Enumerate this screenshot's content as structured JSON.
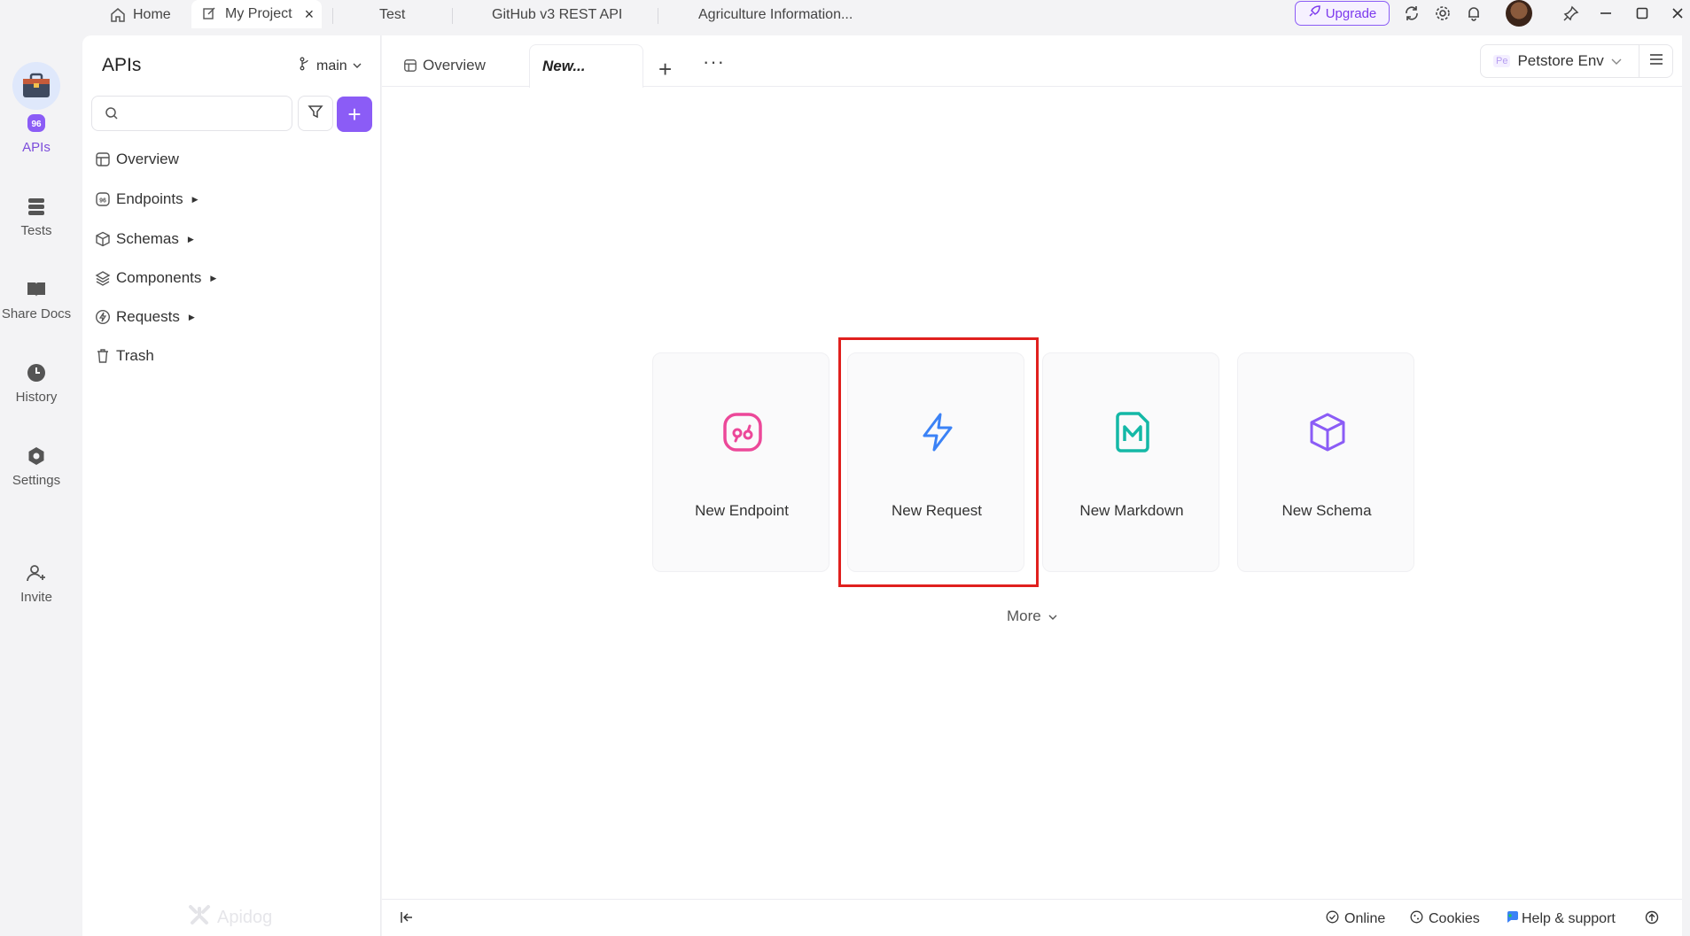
{
  "titlebar": {
    "tabs": [
      {
        "label": "Home"
      },
      {
        "label": "My Project"
      },
      {
        "label": "Test"
      },
      {
        "label": "GitHub v3 REST API"
      },
      {
        "label": "Agriculture Information..."
      }
    ],
    "upgrade_label": "Upgrade"
  },
  "rail": {
    "items": [
      {
        "label": "APIs"
      },
      {
        "label": "Tests"
      },
      {
        "label": "Share Docs"
      },
      {
        "label": "History"
      },
      {
        "label": "Settings"
      },
      {
        "label": "Invite"
      }
    ]
  },
  "sidebar": {
    "title": "APIs",
    "branch": "main",
    "search_placeholder": "",
    "tree": [
      {
        "label": "Overview"
      },
      {
        "label": "Endpoints"
      },
      {
        "label": "Schemas"
      },
      {
        "label": "Components"
      },
      {
        "label": "Requests"
      },
      {
        "label": "Trash"
      }
    ],
    "watermark": "Apidog"
  },
  "main": {
    "tabs": [
      {
        "label": "Overview"
      },
      {
        "label": "New..."
      }
    ],
    "env_badge": "Pe",
    "env_label": "Petstore Env",
    "cards": [
      {
        "label": "New Endpoint"
      },
      {
        "label": "New Request"
      },
      {
        "label": "New Markdown"
      },
      {
        "label": "New Schema"
      }
    ],
    "more_label": "More"
  },
  "footer": {
    "online": "Online",
    "cookies": "Cookies",
    "help": "Help & support"
  },
  "colors": {
    "accent": "#8b5cf6",
    "highlight": "#e0201e",
    "endpoint_icon": "#ec4899",
    "request_icon": "#3b82f6",
    "markdown_icon": "#14b8a6",
    "schema_icon": "#8b5cf6"
  }
}
